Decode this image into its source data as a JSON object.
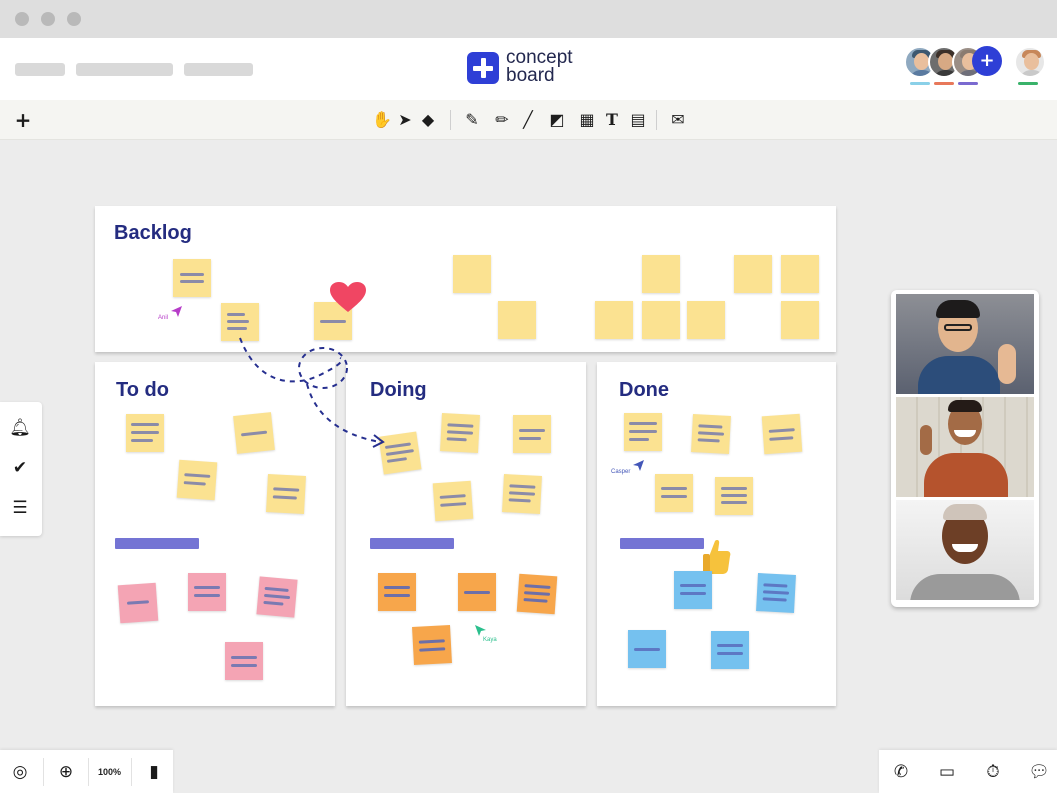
{
  "app": {
    "logo_line1": "concept",
    "logo_line2": "board",
    "brand_color": "#2e3fd6"
  },
  "header": {
    "breadcrumb_placeholders": 3,
    "avatars": [
      "user-avatar",
      "user-avatar",
      "user-avatar"
    ],
    "invite_label": "+",
    "self_avatar": "self-avatar"
  },
  "toolbar": {
    "add_label": "+",
    "tools": [
      "hand-tool",
      "select-tool",
      "eraser-tool",
      "pen-tool",
      "highlighter-tool",
      "line-tool",
      "shapes-tool",
      "table-tool",
      "text-tool",
      "sticky-note-tool",
      "comment-tool"
    ]
  },
  "board": {
    "backlog": {
      "title": "Backlog"
    },
    "todo": {
      "title": "To do"
    },
    "doing": {
      "title": "Doing"
    },
    "done": {
      "title": "Done"
    },
    "cursors": {
      "anil": "Anil",
      "casper": "Casper",
      "kaya": "Kaya"
    }
  },
  "sidebar": {
    "items": [
      "bell-icon",
      "check-circle-icon",
      "list-icon"
    ]
  },
  "footer": {
    "zoom_level": "100%",
    "left_icons": [
      "compass-icon",
      "zoom-icon",
      "mouse-icon"
    ],
    "right_icons": [
      "phone-icon",
      "presentation-icon",
      "timer-icon",
      "chat-icon"
    ]
  },
  "colors": {
    "yellow_note": "#fbe291",
    "pink_note": "#f4a4b4",
    "orange_note": "#f7a64b",
    "blue_note": "#75c1ef",
    "title_text": "#242c80",
    "header_bar": "#7474d4"
  }
}
